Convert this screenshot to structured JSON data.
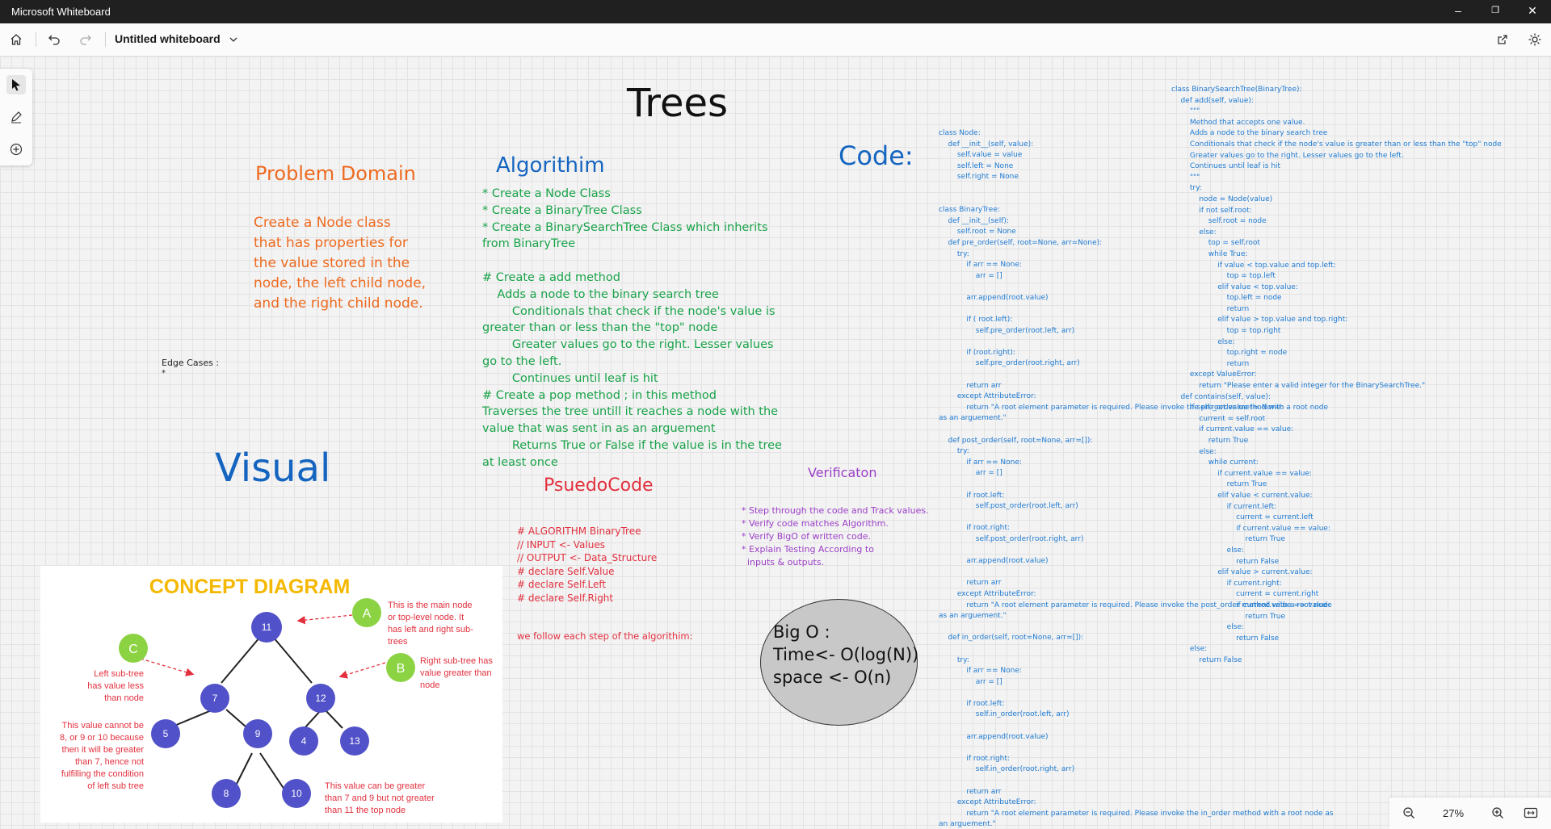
{
  "window": {
    "title": "Microsoft Whiteboard",
    "minimize_glyph": "–",
    "restore_glyph": "❐",
    "close_glyph": "✕"
  },
  "toolbar": {
    "board_title": "Untitled whiteboard"
  },
  "zoom": {
    "level": "27%"
  },
  "board": {
    "title": "Trees",
    "problem_domain": {
      "heading": "Problem Domain",
      "lines": [
        "Create a Node class",
        "that has properties for",
        "the value stored in the",
        "node, the left child node,",
        "and the right child node."
      ]
    },
    "edge_cases": {
      "label": "Edge Cases :",
      "bullet": "*"
    },
    "algorithm": {
      "heading": "Algorithim",
      "lines": [
        "* Create a Node Class",
        "* Create a BinaryTree Class",
        "* Create a BinarySearchTree Class which inherits",
        "from BinaryTree",
        "",
        "# Create a add method",
        "    Adds a node to the binary search tree",
        "        Conditionals that check if the node's value is",
        "greater than or less than the \"top\" node",
        "        Greater values go to the right. Lesser values",
        "go to the left.",
        "        Continues until leaf is hit",
        "# Create a pop method ; in this method",
        "Traverses the tree untill it reaches a node with the",
        "value that was sent in as an arguement",
        "        Returns True or False if the value is in the tree",
        "at least once"
      ]
    },
    "code_heading": "Code:",
    "visual_heading": "Visual",
    "pseudocode": {
      "heading": "PsuedoCode",
      "lines": [
        "# ALGORITHM BinaryTree",
        "// INPUT <- Values",
        "// OUTPUT <- Data_Structure",
        "# declare Self.Value",
        "# declare Self.Left",
        "# declare Self.Right"
      ],
      "footer": "we follow each step of the algorithim:"
    },
    "verification": {
      "heading": "Verificaton",
      "lines": [
        "* Step through the code and Track values.",
        "* Verify code matches Algorithm.",
        "* Verify BigO of written code.",
        "* Explain Testing According to",
        "  inputs & outputs."
      ]
    },
    "big_o": {
      "line1": "Big O :",
      "line2": "Time<- O(log(N))",
      "line3": "space <- O(n)"
    },
    "code_left": [
      "class Node:",
      "    def __init__(self, value):",
      "        self.value = value",
      "        self.left = None",
      "        self.right = None",
      "",
      "",
      "class BinaryTree:",
      "    def __init__(self):",
      "        self.root = None",
      "    def pre_order(self, root=None, arr=None):",
      "        try:",
      "            if arr == None:",
      "                arr = []",
      "",
      "            arr.append(root.value)",
      "",
      "            if ( root.left):",
      "                self.pre_order(root.left, arr)",
      "",
      "            if (root.right):",
      "                self.pre_order(root.right, arr)",
      "",
      "            return arr",
      "        except AttributeError:",
      "            return \"A root element parameter is required. Please invoke the pre_order method with a root node",
      "as an arguement.\"",
      "",
      "    def post_order(self, root=None, arr=[]):",
      "        try:",
      "            if arr == None:",
      "                arr = []",
      "",
      "            if root.left:",
      "                self.post_order(root.left, arr)",
      "",
      "            if root.right:",
      "                self.post_order(root.right, arr)",
      "",
      "            arr.append(root.value)",
      "",
      "            return arr",
      "        except AttributeError:",
      "            return \"A root element parameter is required. Please invoke the post_order method with a root node",
      "as an arguement.\"",
      "",
      "    def in_order(self, root=None, arr=[]):",
      "",
      "        try:",
      "            if arr == None:",
      "                arr = []",
      "",
      "            if root.left:",
      "                self.in_order(root.left, arr)",
      "",
      "            arr.append(root.value)",
      "",
      "            if root.right:",
      "                self.in_order(root.right, arr)",
      "",
      "            return arr",
      "        except AttributeError:",
      "            return \"A root element parameter is required. Please invoke the in_order method with a root node as",
      "an arguement.\""
    ],
    "code_right": [
      "class BinarySearchTree(BinaryTree):",
      "    def add(self, value):",
      "        \"\"\"",
      "        Method that accepts one value.",
      "        Adds a node to the binary search tree",
      "        Conditionals that check if the node's value is greater than or less than the \"top\" node",
      "        Greater values go to the right. Lesser values go to the left.",
      "        Continues until leaf is hit",
      "        \"\"\"",
      "        try:",
      "            node = Node(value)",
      "            if not self.root:",
      "                self.root = node",
      "            else:",
      "                top = self.root",
      "                while True:",
      "                    if value < top.value and top.left:",
      "                        top = top.left",
      "                    elif value < top.value:",
      "                        top.left = node",
      "                        return",
      "                    elif value > top.value and top.right:",
      "                        top = top.right",
      "                    else:",
      "                        top.right = node",
      "                        return",
      "        except ValueError:",
      "            return \"Please enter a valid integer for the BinarySearchTree.\"",
      "    def contains(self, value):",
      "        if self.root.value != None:",
      "            current = self.root",
      "            if current.value == value:",
      "                return True",
      "            else:",
      "                while current:",
      "                    if current.value == value:",
      "                        return True",
      "                    elif value < current.value:",
      "                        if current.left:",
      "                            current = current.left",
      "                            if current.value == value:",
      "                                return True",
      "                        else:",
      "                            return False",
      "                    elif value > current.value:",
      "                        if current.right:",
      "                            current = current.right",
      "                            if current.value == value:",
      "                                return True",
      "                        else:",
      "                            return False",
      "        else:",
      "            return False"
    ],
    "concept_diagram": {
      "title": "CONCEPT DIAGRAM",
      "nodes": [
        "11",
        "7",
        "12",
        "5",
        "9",
        "4",
        "13",
        "8",
        "10"
      ],
      "markers": [
        "A",
        "B",
        "C"
      ],
      "notes": {
        "a": [
          "This is the main node",
          "or top-level node. It",
          "has left and right sub-",
          "trees"
        ],
        "b": [
          "Right sub-tree has",
          "value greater than",
          "node"
        ],
        "c": [
          "Left sub-tree",
          "has value less",
          "than node"
        ],
        "d": [
          "This value cannot be",
          "8, or 9 or 10 because",
          "then it will be greater",
          "than 7, hence not",
          "fulfilling the condition",
          "of left sub tree"
        ],
        "e": [
          "This value can be greater",
          "than 7 and 9 but not greater",
          "than 11 the top node"
        ]
      },
      "colors": {
        "node": "#5151c9",
        "marker": "#8bd343",
        "title": "#f5b800",
        "note": "#e2303e"
      }
    }
  }
}
